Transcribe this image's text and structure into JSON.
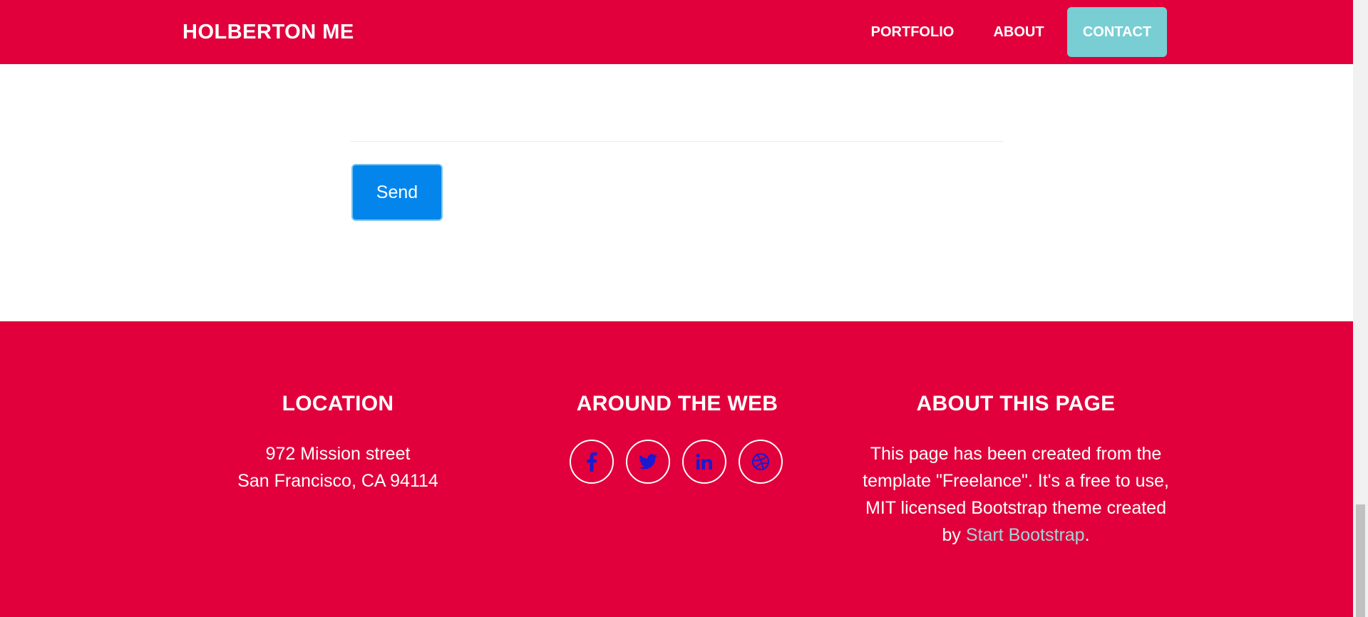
{
  "navbar": {
    "brand": "HOLBERTON ME",
    "items": [
      {
        "label": "PORTFOLIO"
      },
      {
        "label": "ABOUT"
      },
      {
        "label": "CONTACT",
        "active": true
      }
    ]
  },
  "form": {
    "send_label": "Send"
  },
  "footer": {
    "location": {
      "heading": "LOCATION",
      "line1": "972 Mission street",
      "line2": "San Francisco, CA 94114"
    },
    "web": {
      "heading": "AROUND THE WEB",
      "icons": [
        "facebook-icon",
        "twitter-icon",
        "linkedin-icon",
        "dribbble-icon"
      ]
    },
    "about": {
      "heading": "ABOUT THIS PAGE",
      "text_before": "This page has been created from the template \"Freelance\". It's a free to use, MIT licensed Bootstrap theme created by ",
      "link_text": "Start Bootstrap",
      "text_after": "."
    }
  },
  "colors": {
    "primary": "#e1003b",
    "active_nav": "#78ced3",
    "send_button": "#0385ec",
    "icon_color": "#1a1ad2",
    "link": "#9fd6db"
  }
}
